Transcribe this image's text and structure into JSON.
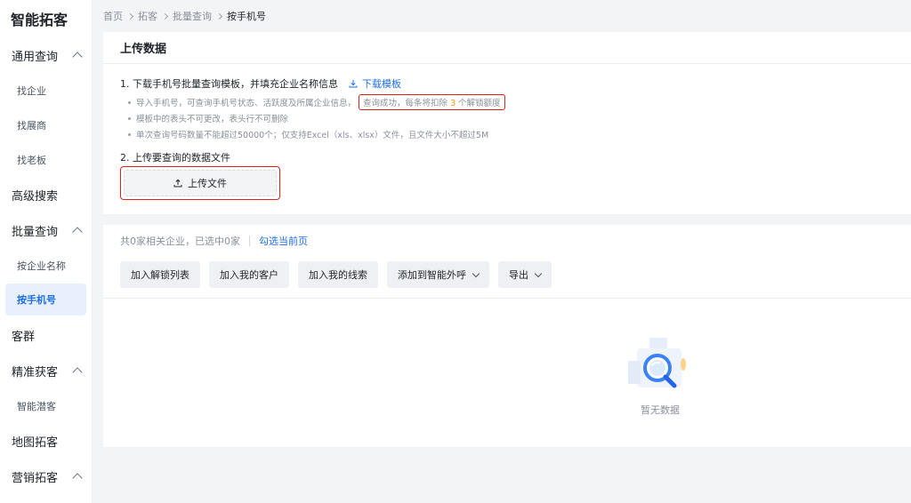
{
  "brand": "智能拓客",
  "sidebar": {
    "groups": [
      {
        "label": "通用查询",
        "items": [
          "找企业",
          "找展商",
          "找老板"
        ]
      },
      {
        "label": "高级搜索"
      },
      {
        "label": "批量查询",
        "items": [
          "按企业名称",
          "按手机号"
        ]
      },
      {
        "label": "客群"
      },
      {
        "label": "精准获客",
        "items": [
          "智能潜客"
        ]
      },
      {
        "label": "地图拓客"
      },
      {
        "label": "营销拓客"
      }
    ],
    "active_item": "按手机号"
  },
  "breadcrumb": [
    "首页",
    "拓客",
    "批量查询",
    "按手机号"
  ],
  "upload": {
    "title": "上传数据",
    "step1": "1. 下载手机号批量查询模板，并填充企业名称信息",
    "download_link": "下载模板",
    "bullet1_pre": "导入手机号，可查询手机号状态、活跃度及所属企业信息，",
    "bullet1_hl_pre": "查询成功，每条将扣除",
    "bullet1_hl_num": "3",
    "bullet1_hl_post": "个解锁额度",
    "bullet2": "模板中的表头不可更改，表头行不可删除",
    "bullet3": "单次查询号码数量不能超过50000个；仅支持Excel（xls、xlsx）文件，且文件大小不超过5M",
    "step2": "2. 上传要查询的数据文件",
    "upload_button": "上传文件"
  },
  "result": {
    "summary": "共0家相关企业，已选中0家",
    "select_page": "勾选当前页",
    "actions": [
      "加入解锁列表",
      "加入我的客户",
      "加入我的线索",
      "添加到智能外呼",
      "导出"
    ],
    "empty_text": "暂无数据"
  },
  "colors": {
    "accent": "#1f6feb",
    "highlight_border": "#e02020",
    "quota_number": "#f59e0b"
  }
}
